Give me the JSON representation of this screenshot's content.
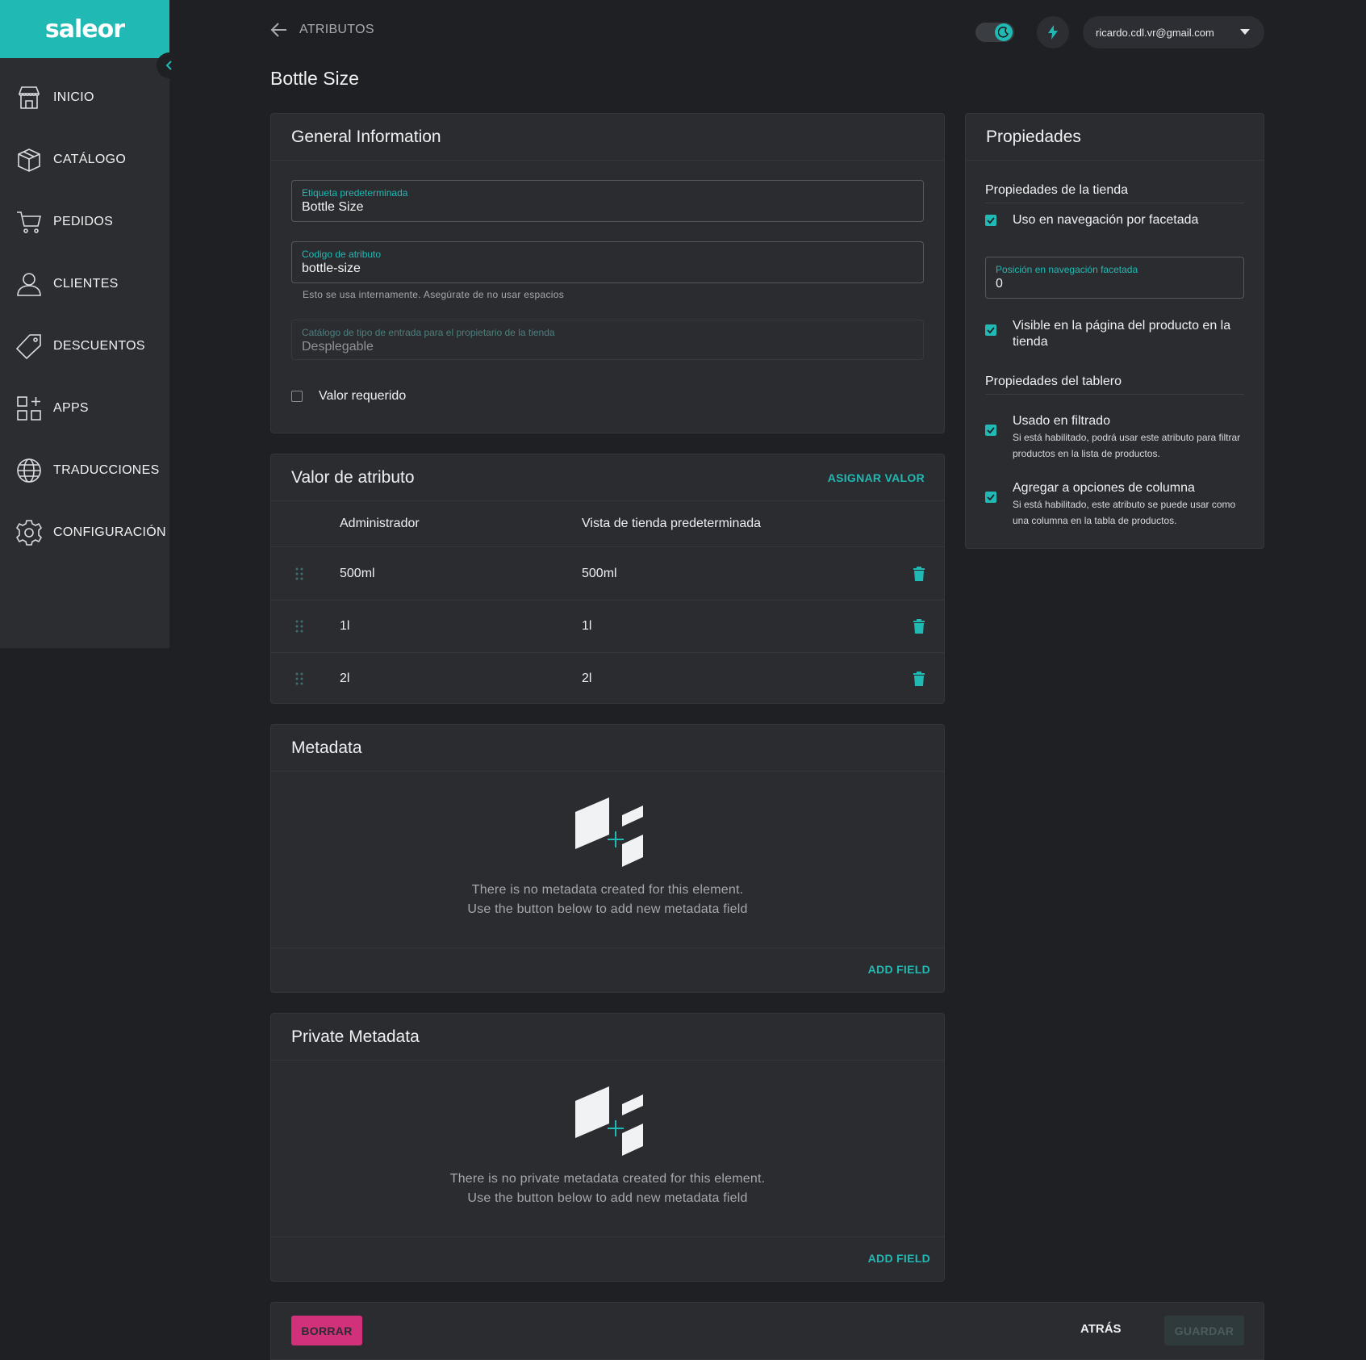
{
  "app": {
    "logo": "saleor"
  },
  "sidebar": {
    "items": [
      {
        "label": "INICIO",
        "icon": "store-icon"
      },
      {
        "label": "CATÁLOGO",
        "icon": "box-icon"
      },
      {
        "label": "PEDIDOS",
        "icon": "cart-icon"
      },
      {
        "label": "CLIENTES",
        "icon": "user-icon"
      },
      {
        "label": "DESCUENTOS",
        "icon": "tag-icon"
      },
      {
        "label": "APPS",
        "icon": "apps-icon"
      },
      {
        "label": "TRADUCCIONES",
        "icon": "globe-icon"
      },
      {
        "label": "CONFIGURACIÓN",
        "icon": "gear-icon"
      }
    ]
  },
  "topbar": {
    "back_label": "ATRIBUTOS",
    "user_email": "ricardo.cdl.vr@gmail.com"
  },
  "page": {
    "title": "Bottle Size"
  },
  "general": {
    "title": "General Information",
    "default_label": {
      "label": "Etiqueta predeterminada",
      "value": "Bottle Size"
    },
    "attribute_code": {
      "label": "Codigo de atributo",
      "value": "bottle-size",
      "helper": "Esto se usa internamente. Asegúrate de no usar espacios"
    },
    "input_type": {
      "label": "Catálogo de tipo de entrada para el propietario de la tienda",
      "value": "Desplegable"
    },
    "value_required": {
      "label": "Valor requerido",
      "checked": false
    }
  },
  "values": {
    "title": "Valor de atributo",
    "assign_label": "ASIGNAR VALOR",
    "columns": [
      "Administrador",
      "Vista de tienda predeterminada"
    ],
    "rows": [
      {
        "admin": "500ml",
        "store": "500ml"
      },
      {
        "admin": "1l",
        "store": "1l"
      },
      {
        "admin": "2l",
        "store": "2l"
      }
    ]
  },
  "metadata": {
    "title": "Metadata",
    "empty_line1": "There is no metadata created for this element.",
    "empty_line2": "Use the button below to add new metadata field",
    "add_label": "ADD FIELD"
  },
  "private_metadata": {
    "title": "Private Metadata",
    "empty_line1": "There is no private metadata created for this element.",
    "empty_line2": "Use the button below to add new metadata field",
    "add_label": "ADD FIELD"
  },
  "properties": {
    "title": "Propiedades",
    "store_section": "Propiedades de la tienda",
    "faceted_nav": {
      "label": "Uso en navegación por facetada",
      "checked": true
    },
    "position": {
      "label": "Posición en navegación facetada",
      "value": "0"
    },
    "visible_pdp": {
      "label": "Visible en la página del producto en la tienda",
      "checked": true
    },
    "dashboard_section": "Propiedades del tablero",
    "used_in_filter": {
      "label": "Usado en filtrado",
      "sub": "Si está habilitado, podrá usar este atributo para filtrar productos en la lista de productos.",
      "checked": true
    },
    "column_option": {
      "label": "Agregar a opciones de columna",
      "sub": "Si está habilitado, este atributo se puede usar como una columna en la tabla de productos.",
      "checked": true
    }
  },
  "savebar": {
    "delete_label": "BORRAR",
    "back_label": "ATRÁS",
    "save_label": "GUARDAR"
  },
  "colors": {
    "accent": "#21b9b4",
    "danger": "#d1307b",
    "background": "#1f2023",
    "surface": "#2a2c30"
  }
}
